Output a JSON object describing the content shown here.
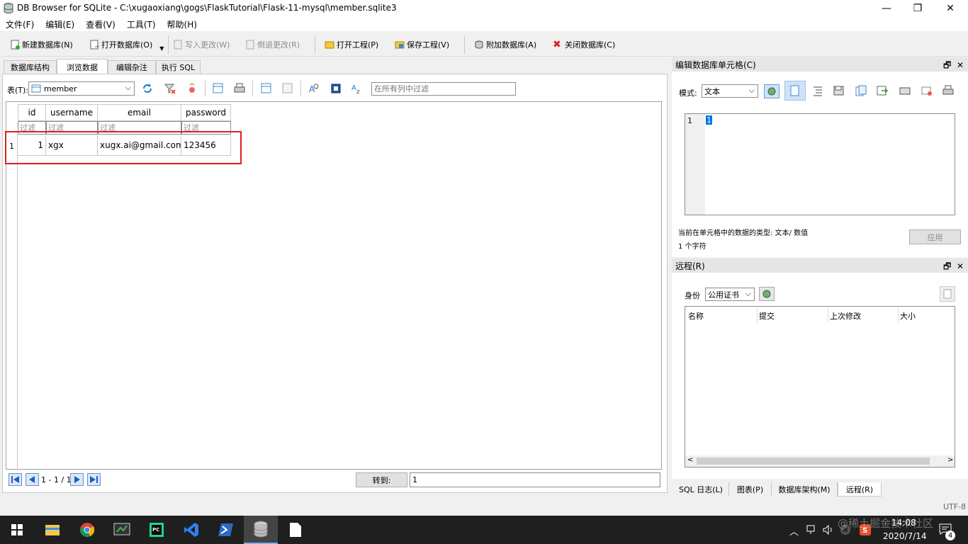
{
  "window": {
    "title": "DB Browser for SQLite - C:\\xugaoxiang\\gogs\\FlaskTutorial\\Flask-11-mysql\\member.sqlite3"
  },
  "menu": [
    "文件(F)",
    "编辑(E)",
    "查看(V)",
    "工具(T)",
    "帮助(H)"
  ],
  "toolbar": {
    "new_db": "新建数据库(N)",
    "open_db": "打开数据库(O)",
    "write_changes": "写入更改(W)",
    "revert_changes": "倒退更改(R)",
    "open_project": "打开工程(P)",
    "save_project": "保存工程(V)",
    "attach_db": "附加数据库(A)",
    "close_db": "关闭数据库(C)"
  },
  "tabs": [
    "数据库结构",
    "浏览数据",
    "编辑杂注",
    "执行 SQL"
  ],
  "browse": {
    "table_label": "表(T):",
    "table_selected": "member",
    "filter_placeholder": "在所有列中过滤",
    "columns": [
      "id",
      "username",
      "email",
      "password"
    ],
    "filter_text": "过滤",
    "rows": [
      {
        "rownum": "1",
        "id": "1",
        "username": "xgx",
        "email": "xugx.ai@gmail.com",
        "password": "123456"
      }
    ],
    "pager": "1 - 1 / 1",
    "goto_label": "转到:",
    "goto_value": "1"
  },
  "edit_cell": {
    "title": "编辑数据库单元格(C)",
    "mode_label": "模式:",
    "mode_value": "文本",
    "line_number": "1",
    "content": "1",
    "type_info": "当前在单元格中的数据的类型: 文本/ 数值",
    "char_count": "1 个字符",
    "apply": "应用"
  },
  "remote": {
    "title": "远程(R)",
    "identity_label": "身份",
    "identity_value": "公用证书",
    "columns": [
      "名称",
      "提交",
      "上次修改",
      "大小"
    ]
  },
  "bottom_tabs": [
    "SQL 日志(L)",
    "图表(P)",
    "数据库架构(M)",
    "远程(R)"
  ],
  "status": {
    "encoding": "UTF-8"
  },
  "taskbar": {
    "time": "14:08",
    "date": "2020/7/14",
    "notifications": "4",
    "watermark": "@稀土掘金技术社区"
  },
  "colors": {
    "highlight_border": "#e02020",
    "selection": "#0078d7",
    "taskbar": "#1f1f1f"
  }
}
